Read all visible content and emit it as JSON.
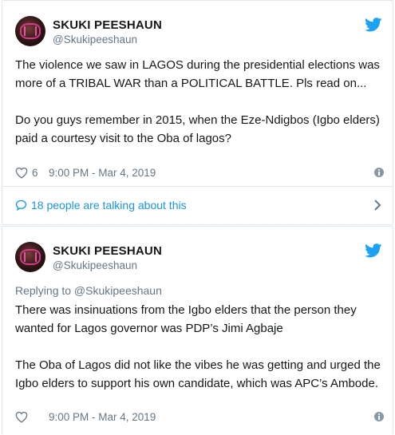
{
  "tweets": [
    {
      "author_name": "SKUKI PEESHAUN",
      "author_handle": "@Skukipeeshaun",
      "paragraphs": [
        "The violence we saw in LAGOS during the presidential elections was more of a TRIBAL WAR than a POLITICAL BATTLE. Pls read on...",
        "Do you guys remember in 2015, when the Eze-Ndigbos (Igbo elders) paid a courtesy visit to the Oba of lagos?"
      ],
      "like_count": "6",
      "timestamp": "9:00 PM - Mar 4, 2019",
      "conversation_label": "18 people are talking about this"
    },
    {
      "author_name": "SKUKI PEESHAUN",
      "author_handle": "@Skukipeeshaun",
      "replying_to": "Replying to @Skukipeeshaun",
      "paragraphs": [
        "There was insinuations from the Igbo elders that the person they wanted for Lagos governor was PDP’s Jimi Agbaje",
        "The Oba of Lagos did not like the vibes he was getting and urged the Igbo elders to support his own candidate, which was APC’s Ambode."
      ],
      "like_count": "",
      "timestamp": "9:00 PM - Mar 4, 2019"
    }
  ],
  "icons": {
    "brand": "twitter-bird-icon",
    "like": "heart-icon",
    "info": "info-icon",
    "conversation": "speech-bubble-icon",
    "more": "chevron-right-icon"
  },
  "colors": {
    "twitter_blue": "#1da1f2",
    "link_blue": "#1b95e0",
    "secondary_text": "#657786",
    "primary_text": "#14171a",
    "border": "#e1e8ed"
  }
}
